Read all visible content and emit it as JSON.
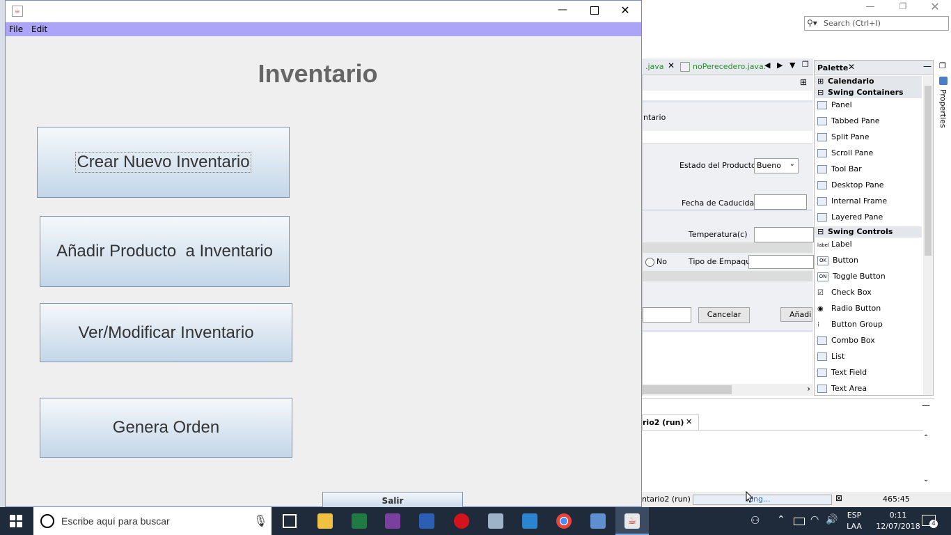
{
  "ide": {
    "search_placeholder": "Search (Ctrl+I)",
    "tabs": [
      ".java",
      "noPerecedero.java."
    ],
    "form": {
      "partial_title": "ntario",
      "estado_label": "Estado del Producto",
      "estado_value": "Bueno",
      "fecha_label": "Fecha de Caducidad",
      "temperatura_label": "Temperatura(c)",
      "no_label": "No",
      "empaque_label": "Tipo de Empaque",
      "cancelar_label": "Cancelar",
      "anadir_label": "Añadi"
    },
    "palette": {
      "title": "Palette",
      "categories": [
        {
          "label": "Calendario"
        },
        {
          "label": "Swing Containers"
        },
        {
          "label": "Swing Controls"
        }
      ],
      "containers": [
        "Panel",
        "Tabbed Pane",
        "Split Pane",
        "Scroll Pane",
        "Tool Bar",
        "Desktop Pane",
        "Internal Frame",
        "Layered Pane"
      ],
      "controls": [
        "Label",
        "Button",
        "Toggle Button",
        "Check Box",
        "Radio Button",
        "Button Group",
        "Combo Box",
        "List",
        "Text Field",
        "Text Area"
      ],
      "control_icon_text": [
        "label",
        "OK",
        "ON"
      ]
    },
    "properties_label": "Properties",
    "output_tab": "rio2 (run)",
    "status": {
      "run_label": "ntario2 (run)",
      "progress_text": "ning...",
      "position": "465:45"
    }
  },
  "app": {
    "menu": [
      "File",
      "Edit"
    ],
    "title": "Inventario",
    "buttons": {
      "crear": "Crear Nuevo Inventario",
      "anadir": "Añadir Producto  a Inventario",
      "ver": "Ver/Modificar Inventario",
      "genera": "Genera Orden",
      "salir": "Salir"
    }
  },
  "taskbar": {
    "search_text": "Escribe aquí para buscar",
    "lang_top": "ESP",
    "lang_bottom": "LAA",
    "time": "0:11",
    "date": "12/07/2018",
    "notifications": "4"
  }
}
